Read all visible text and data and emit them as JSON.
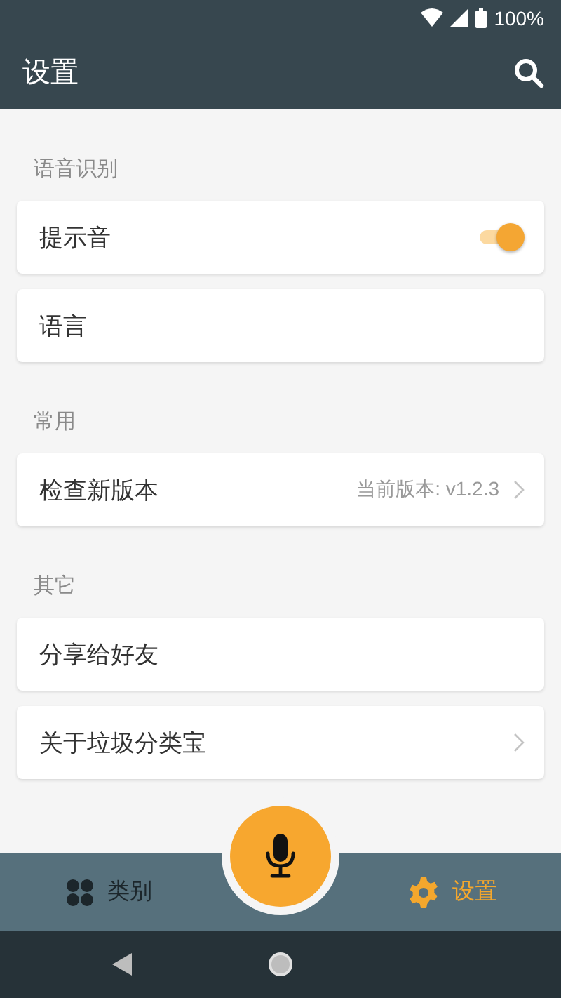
{
  "status_bar": {
    "battery": "100%"
  },
  "app_bar": {
    "title": "设置"
  },
  "sections": [
    {
      "header": "语音识别",
      "items": [
        {
          "kind": "toggle",
          "label": "提示音",
          "on": true
        },
        {
          "kind": "plain",
          "label": "语言"
        }
      ]
    },
    {
      "header": "常用",
      "items": [
        {
          "kind": "link",
          "label": "检查新版本",
          "value": "当前版本: v1.2.3"
        }
      ]
    },
    {
      "header": "其它",
      "items": [
        {
          "kind": "plain",
          "label": "分享给好友"
        },
        {
          "kind": "link",
          "label": "关于垃圾分类宝"
        }
      ]
    }
  ],
  "bottom_nav": [
    {
      "kind": "grid",
      "label": "类别",
      "selected": false
    },
    {
      "kind": "gear",
      "label": "设置",
      "selected": true
    }
  ]
}
